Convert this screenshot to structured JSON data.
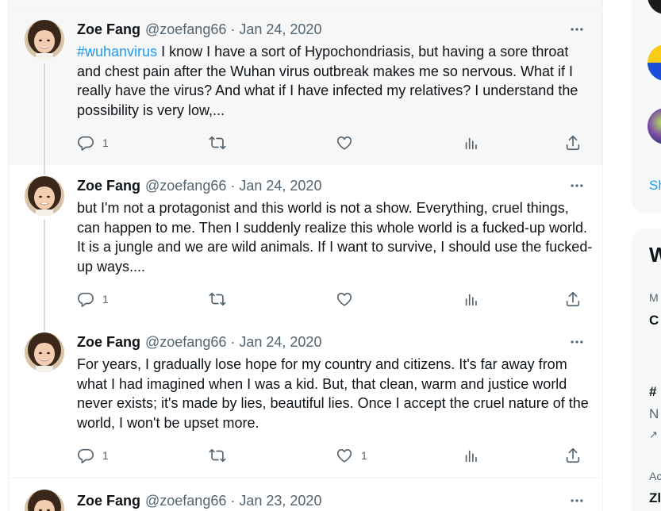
{
  "tweets": [
    {
      "name": "Zoe Fang",
      "handle": "@zoefang66",
      "sep": "·",
      "date": "Jan 24, 2020",
      "hashtag": "#wuhanvirus",
      "text": " I know I have a sort of Hypochondriasis, but having a sore throat and chest pain after the Wuhan virus outbreak makes me so nervous. What if I really have the virus? And what if I have infected my relatives? I understand the possibility is very low,...",
      "replies": "1",
      "retweets": "",
      "likes": "",
      "views": ""
    },
    {
      "name": "Zoe Fang",
      "handle": "@zoefang66",
      "sep": "·",
      "date": "Jan 24, 2020",
      "text": "but I'm not a protagonist and this world is not a show. Everything, cruel things, can happen to me. Then I suddenly realize this whole world is a fucked-up world. It is a jungle and we are wild animals. If I want to survive, I should use the fucked-up ways....",
      "replies": "1",
      "retweets": "",
      "likes": "",
      "views": ""
    },
    {
      "name": "Zoe Fang",
      "handle": "@zoefang66",
      "sep": "·",
      "date": "Jan 24, 2020",
      "text": "For years, I gradually lose hope for my country and citizens. It's far away from what I had imagined when I was a kid. But, that clean, warm and justice world never exists; it's made by lies, beautiful lies. Once I accept the cruel nature of the world, I won't be upset more.",
      "replies": "1",
      "retweets": "",
      "likes": "1",
      "views": ""
    },
    {
      "name": "Zoe Fang",
      "handle": "@zoefang66",
      "sep": "·",
      "date": "Jan 23, 2020"
    }
  ],
  "right_column": {
    "show_more_partial": "Sh",
    "section_title_partial": "W",
    "items": [
      {
        "line1": "M",
        "line2": "C"
      },
      {
        "line1": "#",
        "line2": "N",
        "line3": "↗"
      },
      {
        "line1": "Ac",
        "line2": "Zl"
      }
    ]
  },
  "icons": [
    "more-icon",
    "reply-icon",
    "retweet-icon",
    "like-icon",
    "views-icon",
    "share-icon"
  ],
  "colors": {
    "link": "#1d9bf0",
    "secondary": "#536471",
    "hover_bg": "#f7f7f7",
    "thread": "#cfd9de"
  }
}
